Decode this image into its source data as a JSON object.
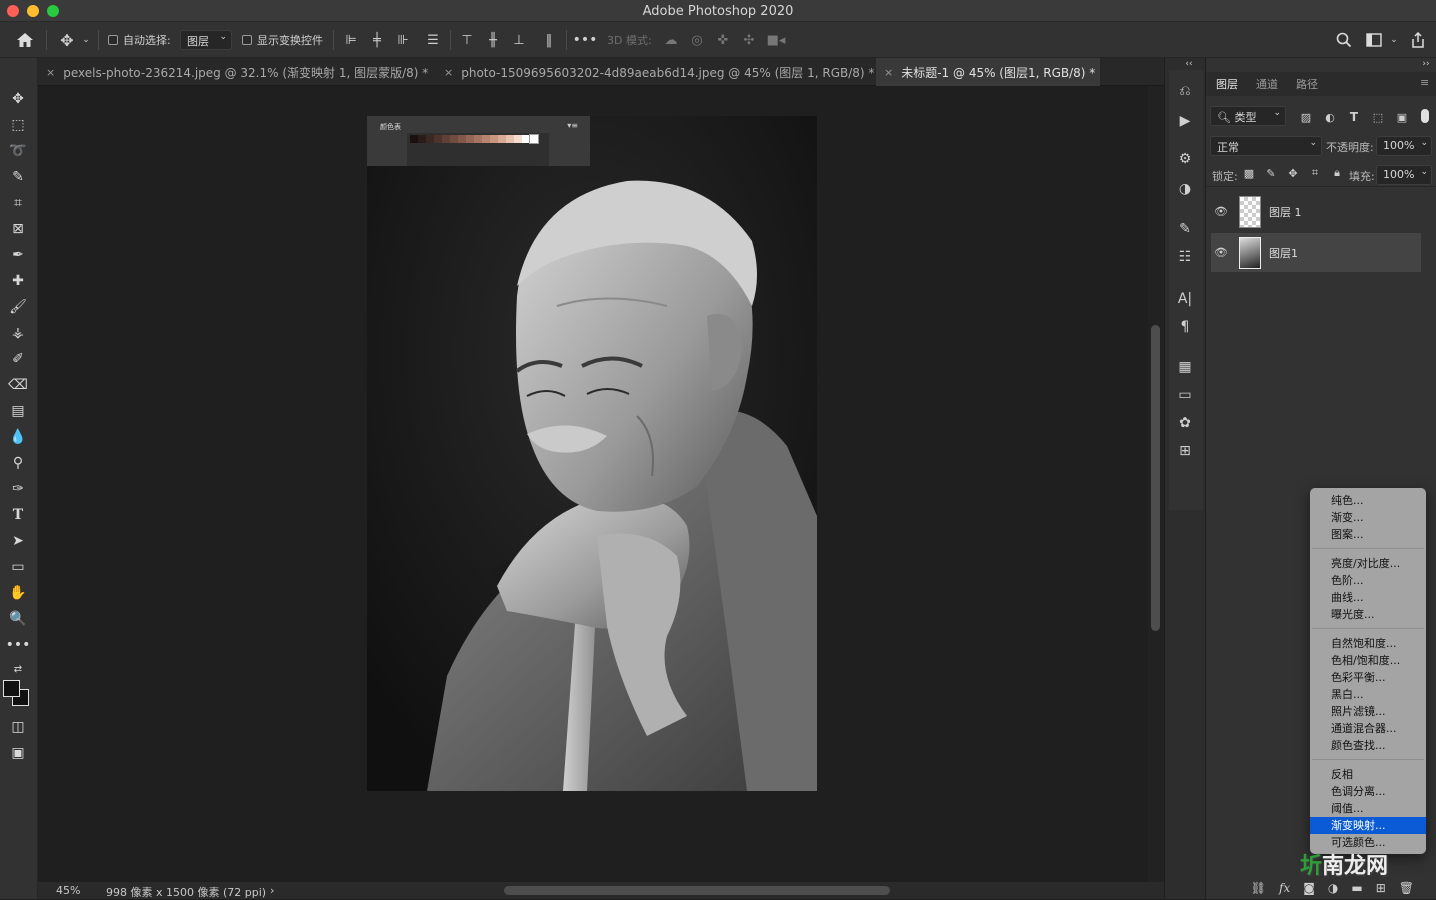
{
  "window": {
    "title": "Adobe Photoshop 2020"
  },
  "options_bar": {
    "auto_select_label": "自动选择:",
    "auto_select_value": "图层",
    "show_transform_label": "显示变换控件",
    "three_d_mode_label": "3D 模式:"
  },
  "tabs": [
    {
      "label": "pexels-photo-236214.jpeg @ 32.1% (渐变映射 1, 图层蒙版/8) *",
      "close": "×"
    },
    {
      "label": "photo-1509695603202-4d89aeab6d14.jpeg @ 45% (图层 1, RGB/8) *",
      "close": "×"
    },
    {
      "label": "未标题-1 @ 45% (图层1, RGB/8) *",
      "close": "×",
      "active": true
    }
  ],
  "swatch_panel": {
    "label": "颜色表",
    "menu": "▾≡",
    "colors": [
      "#1a1210",
      "#2a1c18",
      "#3a2822",
      "#4c342c",
      "#5e4036",
      "#704c40",
      "#82584a",
      "#946656",
      "#a67462",
      "#b8846f",
      "#c8967f",
      "#d8aa94",
      "#e8c2ae",
      "#f4dccf",
      "#ffffff",
      "#ffffff"
    ]
  },
  "status": {
    "zoom": "45%",
    "doc_info": "998 像素 x 1500 像素 (72 ppi)",
    "arrow": "›"
  },
  "layers_panel": {
    "tabs": [
      "图层",
      "通道",
      "路径"
    ],
    "filter_kind": "类型",
    "blend_mode": "正常",
    "opacity_label": "不透明度:",
    "opacity_value": "100%",
    "lock_label": "锁定:",
    "fill_label": "填充:",
    "fill_value": "100%",
    "layers": [
      {
        "name": "图层 1",
        "selected": false
      },
      {
        "name": "图层1",
        "selected": true
      }
    ]
  },
  "adjust_menu": {
    "group1": [
      "纯色...",
      "渐变...",
      "图案..."
    ],
    "group2": [
      "亮度/对比度...",
      "色阶...",
      "曲线...",
      "曝光度..."
    ],
    "group3": [
      "自然饱和度...",
      "色相/饱和度...",
      "色彩平衡...",
      "黑白...",
      "照片滤镜...",
      "通道混合器...",
      "颜色查找..."
    ],
    "group4": [
      "反相",
      "色调分离...",
      "阈值...",
      "渐变映射...",
      "可选颜色..."
    ],
    "selected": "渐变映射..."
  },
  "watermark": {
    "part1": "圻",
    "part2": "南龙网"
  },
  "colors": {
    "accent": "#0b5bd6",
    "panel_bg": "#323232"
  }
}
